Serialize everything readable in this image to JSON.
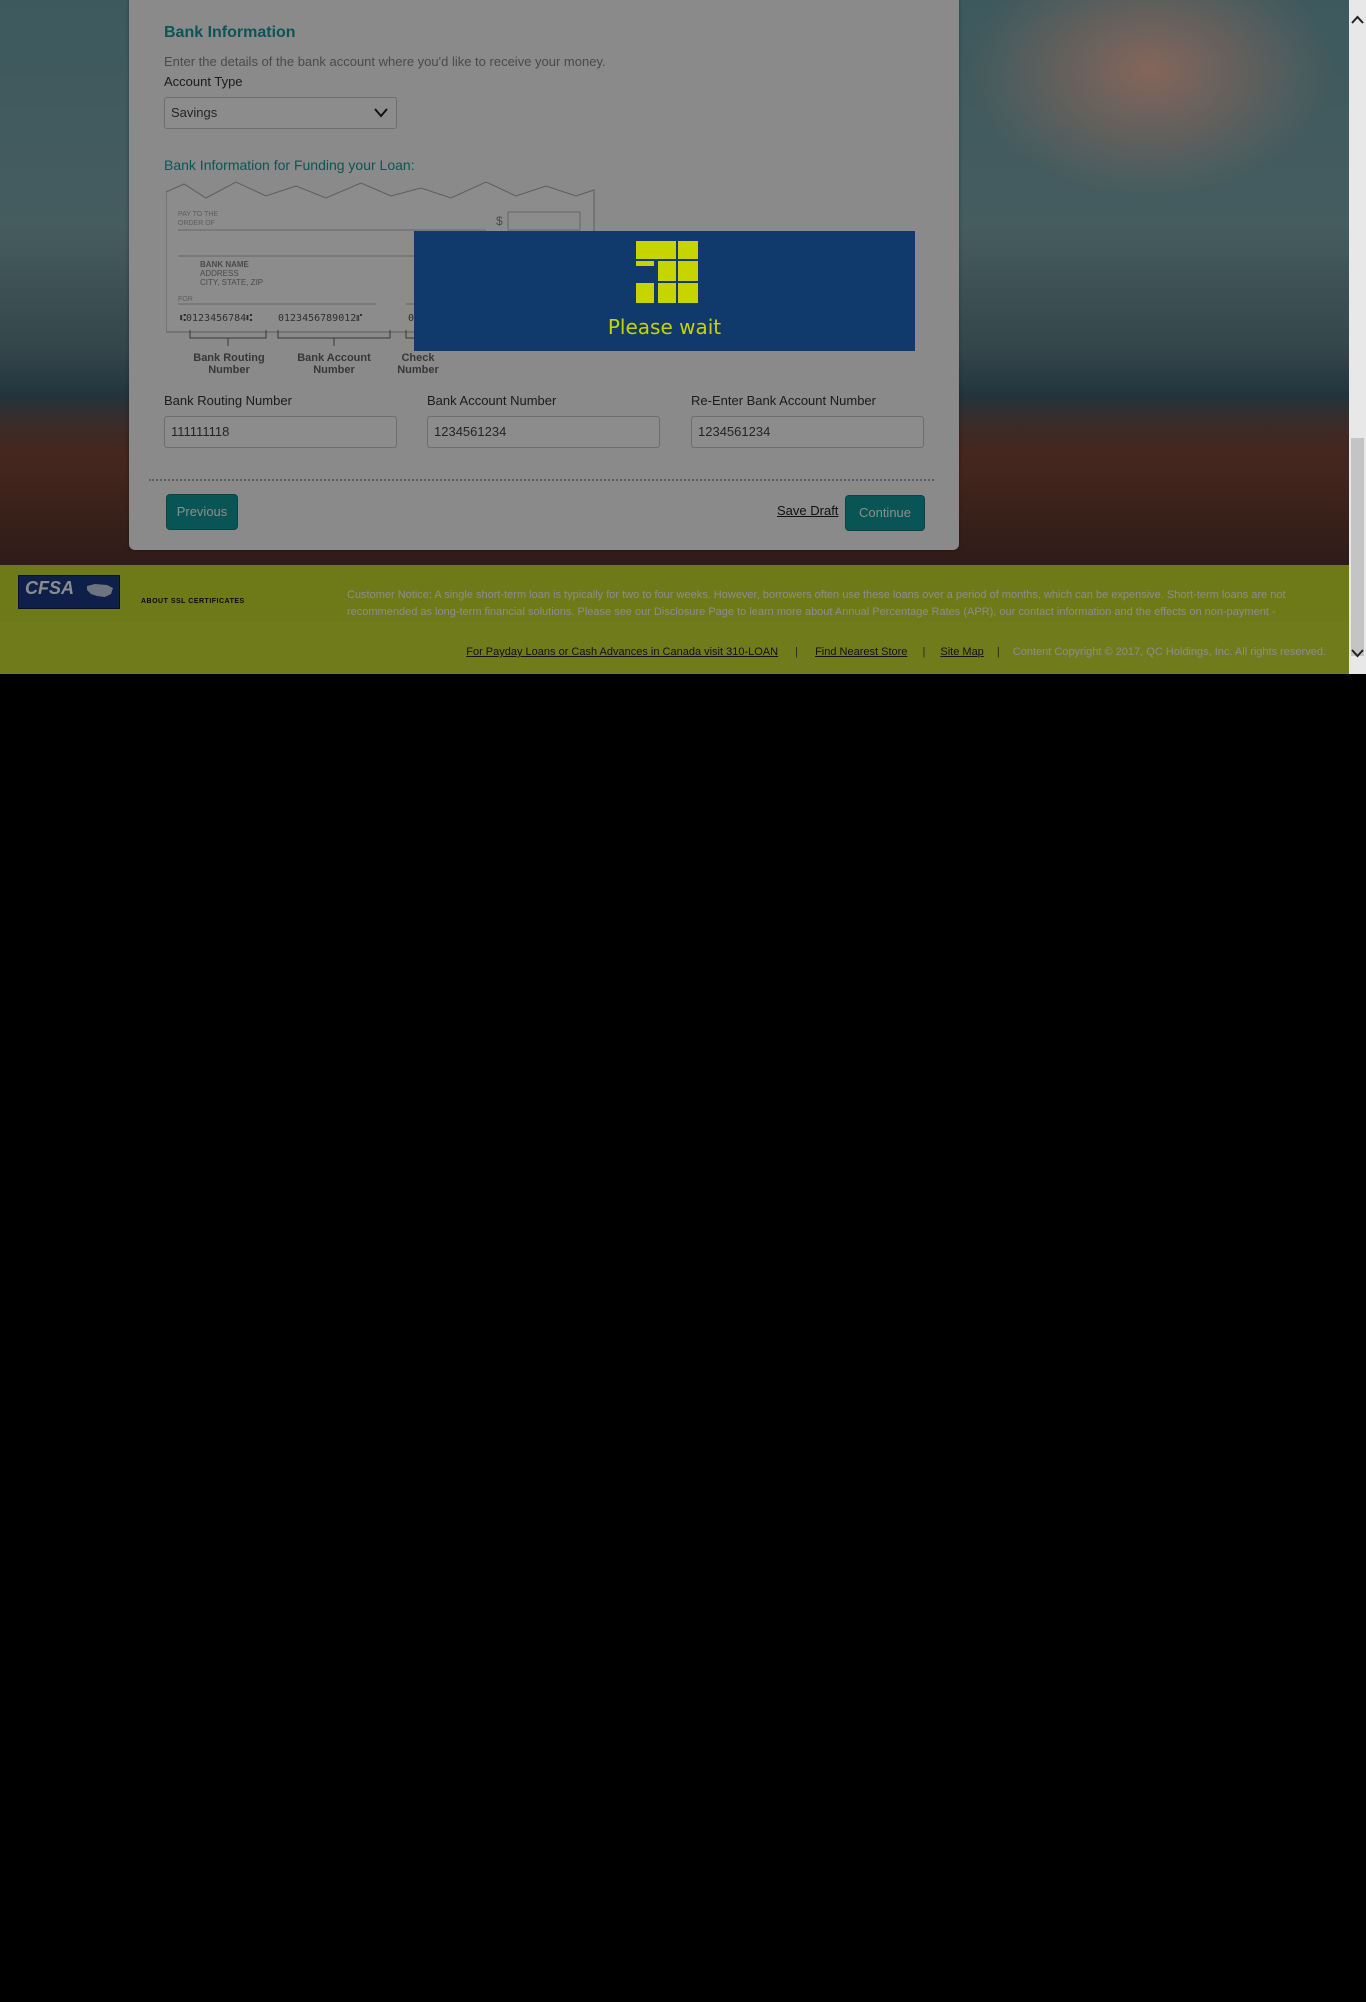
{
  "form": {
    "section_title": "Bank Information",
    "instructions": "Enter the details of the bank account where you'd like to receive your money.",
    "account_type_label": "Account Type",
    "account_type_value": "Savings",
    "funding_title": "Bank Information for Funding your Loan:",
    "check": {
      "pay_to_line1": "PAY TO THE",
      "pay_to_line2": "ORDER OF",
      "dollar": "$",
      "bank_name": "BANK NAME",
      "address": "ADDRESS",
      "city_state_zip": "CITY, STATE, ZIP",
      "for": "FOR",
      "micr_routing": "⑆0123456784⑆",
      "micr_account": "0123456789012⑈",
      "micr_check": "0",
      "routing_caption": [
        "Bank Routing",
        "Number"
      ],
      "account_caption": [
        "Bank Account",
        "Number"
      ],
      "check_caption": [
        "Check",
        "Number"
      ]
    },
    "routing_label": "Bank Routing Number",
    "routing_value": "111111118",
    "account_label": "Bank Account Number",
    "account_value": "1234561234",
    "reenter_label": "Re-Enter Bank Account Number",
    "reenter_value": "1234561234",
    "previous_label": "Previous",
    "save_draft_label": "Save Draft",
    "continue_label": "Continue"
  },
  "modal": {
    "text": "Please wait",
    "accent": "#c8d400",
    "background": "#0f3a6b"
  },
  "footer": {
    "cfsa_logo": "CFSA",
    "about_ssl": "ABOUT SSL CERTIFICATES",
    "notice": "Customer Notice: A single short-term loan is typically for two to four weeks. However, borrowers often use these loans over a period of months, which can be expensive. Short-term loans are not recommended as long-term financial solutions. Please see our Disclosure Page to learn more about Annual Percentage Rates (APR), our contact information and the effects on non-payment - including collection and renewal practices.",
    "links": [
      "For Payday Loans or Cash Advances in Canada visit 310-LOAN",
      "Find Nearest Store",
      "Site Map"
    ],
    "copyright": "Content Copyright © 2017, QC Holdings, Inc. All rights reserved."
  },
  "colors": {
    "teal": "#129a9a",
    "footer_lime": "#cde033"
  }
}
